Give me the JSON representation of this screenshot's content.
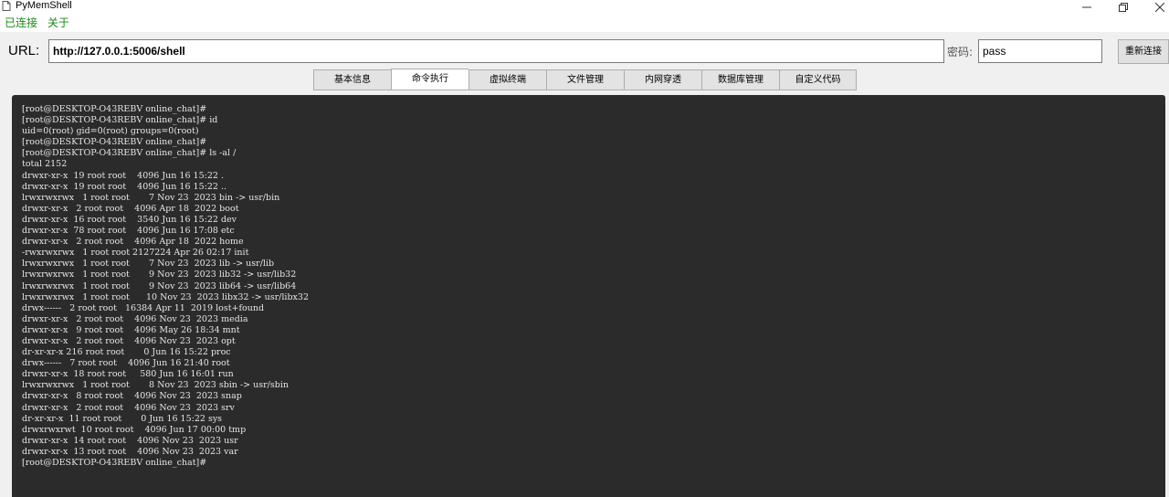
{
  "window": {
    "title": "PyMemShell",
    "app_icon": "document-icon",
    "controls": {
      "minimize_icon": "minimize-icon",
      "maximize_icon": "restore-icon",
      "close_icon": "close-icon"
    }
  },
  "menu": {
    "connected": "已连接",
    "about": "关于",
    "color": "#1a8a1a"
  },
  "connection": {
    "url_label": "URL:",
    "url_value": "http://127.0.0.1:5006/shell",
    "password_label": "密码:",
    "password_value": "pass",
    "reconnect_label": "重新连接"
  },
  "tabs": [
    {
      "label": "基本信息",
      "active": false
    },
    {
      "label": "命令执行",
      "active": true
    },
    {
      "label": "虚拟终端",
      "active": false
    },
    {
      "label": "文件管理",
      "active": false
    },
    {
      "label": "内网穿透",
      "active": false
    },
    {
      "label": "数据库管理",
      "active": false
    },
    {
      "label": "自定义代码",
      "active": false
    }
  ],
  "terminal": {
    "background": "#2b2b2b",
    "foreground": "#e6e6e6",
    "lines": [
      "[root@DESKTOP-O43REBV online_chat]#",
      "[root@DESKTOP-O43REBV online_chat]# id",
      "uid=0(root) gid=0(root) groups=0(root)",
      "[root@DESKTOP-O43REBV online_chat]#",
      "[root@DESKTOP-O43REBV online_chat]# ls -al /",
      "total 2152",
      "drwxr-xr-x  19 root root    4096 Jun 16 15:22 .",
      "drwxr-xr-x  19 root root    4096 Jun 16 15:22 ..",
      "lrwxrwxrwx   1 root root       7 Nov 23  2023 bin -> usr/bin",
      "drwxr-xr-x   2 root root    4096 Apr 18  2022 boot",
      "drwxr-xr-x  16 root root    3540 Jun 16 15:22 dev",
      "drwxr-xr-x  78 root root    4096 Jun 16 17:08 etc",
      "drwxr-xr-x   2 root root    4096 Apr 18  2022 home",
      "-rwxrwxrwx   1 root root 2127224 Apr 26 02:17 init",
      "lrwxrwxrwx   1 root root       7 Nov 23  2023 lib -> usr/lib",
      "lrwxrwxrwx   1 root root       9 Nov 23  2023 lib32 -> usr/lib32",
      "lrwxrwxrwx   1 root root       9 Nov 23  2023 lib64 -> usr/lib64",
      "lrwxrwxrwx   1 root root      10 Nov 23  2023 libx32 -> usr/libx32",
      "drwx------   2 root root   16384 Apr 11  2019 lost+found",
      "drwxr-xr-x   2 root root    4096 Nov 23  2023 media",
      "drwxr-xr-x   9 root root    4096 May 26 18:34 mnt",
      "drwxr-xr-x   2 root root    4096 Nov 23  2023 opt",
      "dr-xr-xr-x 216 root root       0 Jun 16 15:22 proc",
      "drwx------   7 root root    4096 Jun 16 21:40 root",
      "drwxr-xr-x  18 root root     580 Jun 16 16:01 run",
      "lrwxrwxrwx   1 root root       8 Nov 23  2023 sbin -> usr/sbin",
      "drwxr-xr-x   8 root root    4096 Nov 23  2023 snap",
      "drwxr-xr-x   2 root root    4096 Nov 23  2023 srv",
      "dr-xr-xr-x  11 root root       0 Jun 16 15:22 sys",
      "drwxrwxrwt  10 root root    4096 Jun 17 00:00 tmp",
      "drwxr-xr-x  14 root root    4096 Nov 23  2023 usr",
      "drwxr-xr-x  13 root root    4096 Nov 23  2023 var",
      "[root@DESKTOP-O43REBV online_chat]#"
    ]
  }
}
